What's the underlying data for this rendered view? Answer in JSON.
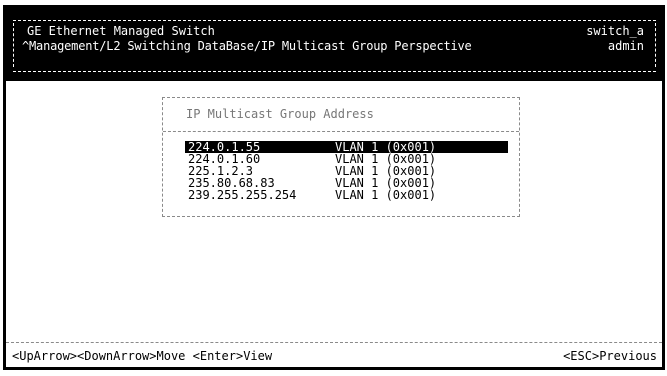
{
  "header": {
    "device_name": "GE Ethernet Managed Switch",
    "menu_path": "^Management/L2 Switching DataBase/IP Multicast Group Perspective",
    "host_name": "switch_a",
    "user_name": "admin"
  },
  "group_list": {
    "title": "IP Multicast Group Address",
    "selected_index": 0,
    "rows": [
      {
        "ip": "224.0.1.55",
        "vlan": "VLAN 1 (0x001)"
      },
      {
        "ip": "224.0.1.60",
        "vlan": "VLAN 1 (0x001)"
      },
      {
        "ip": "225.1.2.3",
        "vlan": "VLAN 1 (0x001)"
      },
      {
        "ip": "235.80.68.83",
        "vlan": "VLAN 1 (0x001)"
      },
      {
        "ip": "239.255.255.254",
        "vlan": "VLAN 1 (0x001)"
      }
    ]
  },
  "footer": {
    "navigation_hint": "<UpArrow><DownArrow>Move <Enter>View",
    "escape_hint": "<ESC>Previous"
  },
  "colors": {
    "header_background": "#000000",
    "header_text": "#ffffff",
    "selection_background": "#000000",
    "selection_text": "#ffffff",
    "page_background": "#ffffff"
  }
}
